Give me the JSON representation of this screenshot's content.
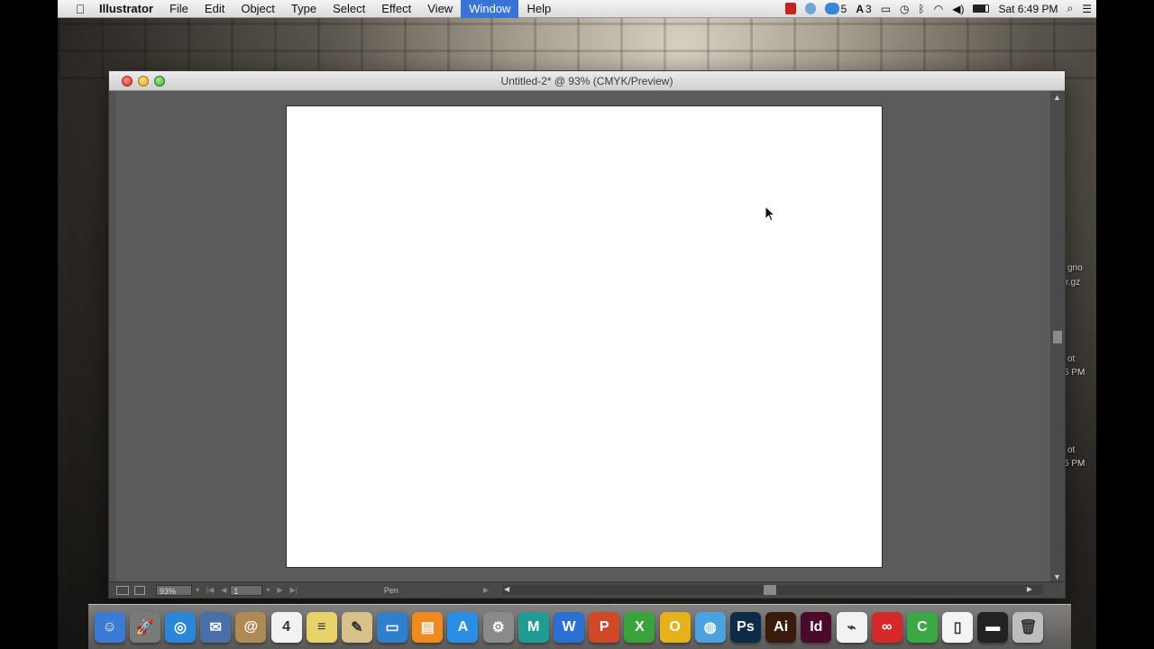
{
  "menubar": {
    "apple": "",
    "app_name": "Illustrator",
    "items": [
      "File",
      "Edit",
      "Object",
      "Type",
      "Select",
      "Effect",
      "View",
      "Window",
      "Help"
    ],
    "active_item": "Window",
    "status": {
      "sync_count": "5",
      "adobe_count": "3",
      "clock": "Sat 6:49 PM"
    }
  },
  "window": {
    "title": "Untitled-2* @ 93% (CMYK/Preview)"
  },
  "statusbar": {
    "zoom": "93%",
    "page": "1",
    "tool": "Pen"
  },
  "desktop_labels": {
    "file1_line1": "gno",
    "file1_line2": "r.gz",
    "file2_line1": "ot",
    "file2_line2": "5 PM",
    "file3_line1": "ot",
    "file3_line2": "5 PM"
  },
  "dock": {
    "items": [
      {
        "icon": "finder-icon",
        "glyph": "☺",
        "color": "#3a7bd5"
      },
      {
        "icon": "launchpad-icon",
        "glyph": "🚀",
        "color": "#7a7a7a"
      },
      {
        "icon": "safari-icon",
        "glyph": "◎",
        "color": "#2a86d8"
      },
      {
        "icon": "mail-icon",
        "glyph": "✉",
        "color": "#4a6fa8"
      },
      {
        "icon": "contacts-icon",
        "glyph": "@",
        "color": "#b08a55"
      },
      {
        "icon": "calendar-icon",
        "glyph": "4",
        "color": "#f2f2f2"
      },
      {
        "icon": "notes-icon",
        "glyph": "≡",
        "color": "#e8d36a"
      },
      {
        "icon": "textedit-icon",
        "glyph": "✎",
        "color": "#d9c28a"
      },
      {
        "icon": "keynote-icon",
        "glyph": "▭",
        "color": "#2f7fcf"
      },
      {
        "icon": "ibooks-icon",
        "glyph": "▤",
        "color": "#f08a1c"
      },
      {
        "icon": "appstore-icon",
        "glyph": "A",
        "color": "#2a8ee6"
      },
      {
        "icon": "systemprefs-icon",
        "glyph": "⚙",
        "color": "#8a8a8a"
      },
      {
        "icon": "maya-icon",
        "glyph": "M",
        "color": "#1f9d94"
      },
      {
        "icon": "word-icon",
        "glyph": "W",
        "color": "#2b6fd3"
      },
      {
        "icon": "powerpoint-icon",
        "glyph": "P",
        "color": "#d24726"
      },
      {
        "icon": "excel-icon",
        "glyph": "X",
        "color": "#3ba33b"
      },
      {
        "icon": "outlook-icon",
        "glyph": "O",
        "color": "#e6b21c"
      },
      {
        "icon": "network-icon",
        "glyph": "◍",
        "color": "#4aa3df"
      },
      {
        "icon": "photoshop-icon",
        "glyph": "Ps",
        "color": "#0c2b4a"
      },
      {
        "icon": "illustrator-icon",
        "glyph": "Ai",
        "color": "#3a1a0a"
      },
      {
        "icon": "indesign-icon",
        "glyph": "Id",
        "color": "#4a0a2a"
      },
      {
        "icon": "acrobat-icon",
        "glyph": "⌁",
        "color": "#f2f2f2"
      },
      {
        "icon": "creativecloud-icon",
        "glyph": "∞",
        "color": "#d62828"
      },
      {
        "icon": "camtasia-icon",
        "glyph": "C",
        "color": "#3aa845"
      },
      {
        "icon": "documents-icon",
        "glyph": "▯",
        "color": "#f4f4f4"
      },
      {
        "icon": "terminal-icon",
        "glyph": "▬",
        "color": "#222222"
      },
      {
        "icon": "trash-icon",
        "glyph": "🗑",
        "color": "#bdbdbd"
      }
    ]
  },
  "colors": {
    "menu_highlight": "#3874d8",
    "window_bg": "#535353",
    "artboard": "#ffffff"
  }
}
